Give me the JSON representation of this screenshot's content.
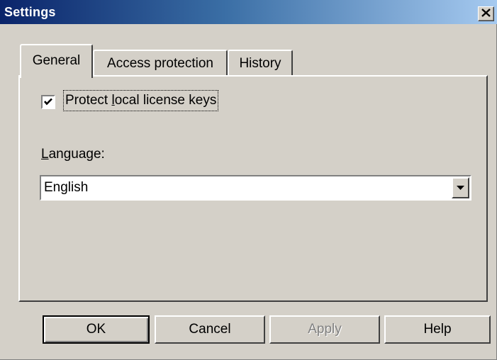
{
  "window": {
    "title": "Settings",
    "close_glyph": "✕"
  },
  "tabs": [
    {
      "label": "General",
      "selected": true
    },
    {
      "label": "Access protection",
      "selected": false
    },
    {
      "label": "History",
      "selected": false
    }
  ],
  "general": {
    "protect_keys": {
      "checked": true,
      "label_pre": "Protect ",
      "label_accel": "l",
      "label_post": "ocal license keys"
    },
    "language": {
      "label_accel": "L",
      "label_post": "anguage:",
      "value": "English"
    }
  },
  "buttons": {
    "ok": "OK",
    "cancel": "Cancel",
    "apply": "Apply",
    "help": "Help"
  },
  "icons": {
    "close": "close-icon",
    "check": "checkmark-icon",
    "dropdown": "dropdown-arrow-icon"
  },
  "colors": {
    "title_gradient_start": "#0a246a",
    "title_gradient_end": "#a6caf0",
    "face": "#d4d0c8",
    "disabled_text": "#808080"
  }
}
